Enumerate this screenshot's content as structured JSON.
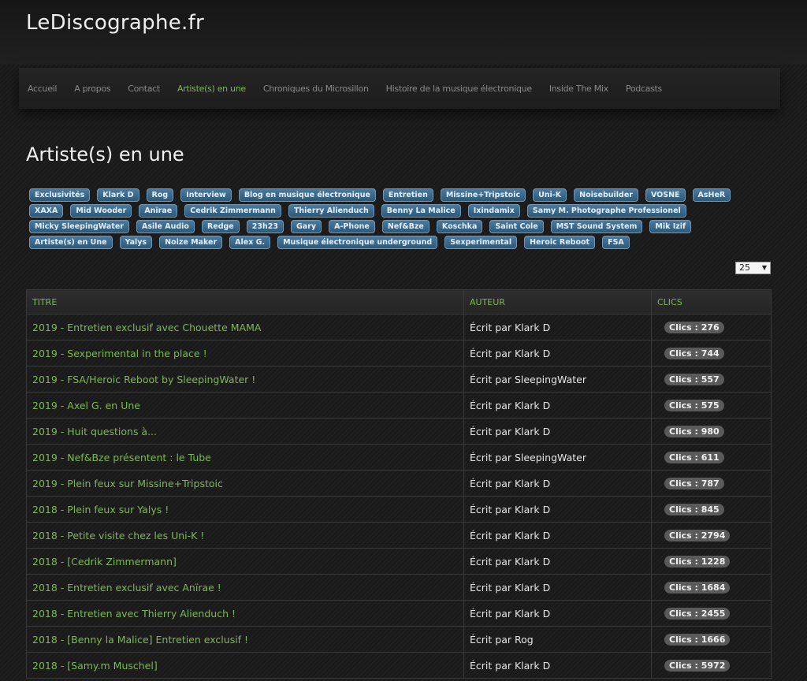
{
  "site": {
    "title": "LeDiscographe.fr"
  },
  "nav": [
    {
      "label": "Accueil",
      "active": false
    },
    {
      "label": "A propos",
      "active": false
    },
    {
      "label": "Contact",
      "active": false
    },
    {
      "label": "Artiste(s) en une",
      "active": true
    },
    {
      "label": "Chroniques du Microsillon",
      "active": false
    },
    {
      "label": "Histoire de la musique électronique",
      "active": false
    },
    {
      "label": "Inside The Mix",
      "active": false
    },
    {
      "label": "Podcasts",
      "active": false
    }
  ],
  "page": {
    "title": "Artiste(s) en une"
  },
  "tags": [
    "Exclusivités",
    "Klark D",
    "Rog",
    "Interview",
    "Blog en musique électronique",
    "Entretien",
    "Missine+Tripstoic",
    "Uni-K",
    "Noisebuilder",
    "VOSNE",
    "AsHeR",
    "XAXA",
    "Mid Wooder",
    "Anïrae",
    "Cedrik Zimmermann",
    "Thierry Alienduch",
    "Benny La Malice",
    "Ixindamix",
    "Samy M. Photographe Professionel",
    "Micky SleepingWater",
    "Asile Audio",
    "Redge",
    "23h23",
    "Gary",
    "A-Phone",
    "Nef&Bze",
    "Koschka",
    "Saint Cole",
    "MST Sound System",
    "Mik Izif",
    "Artiste(s) en Une",
    "Yalys",
    "Noize Maker",
    "Alex G.",
    "Musique électronique underground",
    "Sexperimental",
    "Heroic Reboot",
    "FSA"
  ],
  "list_limit": {
    "value": "25"
  },
  "table": {
    "headers": {
      "title": "TITRE",
      "author": "AUTEUR",
      "clicks": "CLICS"
    },
    "rows": [
      {
        "title": "2019 - Entretien exclusif avec Chouette MAMA",
        "author": "Écrit par Klark D",
        "clicks": "Clics : 276"
      },
      {
        "title": "2019 - Sexperimental in the place !",
        "author": "Écrit par Klark D",
        "clicks": "Clics : 744"
      },
      {
        "title": "2019 - FSA/Heroic Reboot by SleepingWater !",
        "author": "Écrit par SleepingWater",
        "clicks": "Clics : 557"
      },
      {
        "title": "2019 - Axel G. en Une",
        "author": "Écrit par Klark D",
        "clicks": "Clics : 575"
      },
      {
        "title": "2019 - Huit questions à...",
        "author": "Écrit par Klark D",
        "clicks": "Clics : 980"
      },
      {
        "title": "2019 - Nef&Bze présentent : le Tube",
        "author": "Écrit par SleepingWater",
        "clicks": "Clics : 611"
      },
      {
        "title": "2019 - Plein feux sur Missine+Tripstoic",
        "author": "Écrit par Klark D",
        "clicks": "Clics : 787"
      },
      {
        "title": "2018 - Plein feux sur Yalys !",
        "author": "Écrit par Klark D",
        "clicks": "Clics : 845"
      },
      {
        "title": "2018 - Petite visite chez les Uni-K !",
        "author": "Écrit par Klark D",
        "clicks": "Clics : 2794"
      },
      {
        "title": "2018 - [Cedrik Zimmermann]",
        "author": "Écrit par Klark D",
        "clicks": "Clics : 1228"
      },
      {
        "title": "2018 - Entretien exclusif avec Anïrae !",
        "author": "Écrit par Klark D",
        "clicks": "Clics : 1684"
      },
      {
        "title": "2018 - Entretien avec Thierry Alienduch !",
        "author": "Écrit par Klark D",
        "clicks": "Clics : 2455"
      },
      {
        "title": "2018 - [Benny la Malice] Entretien exclusif !",
        "author": "Écrit par Rog",
        "clicks": "Clics : 1666"
      },
      {
        "title": "2018 - [Samy.m Muschel]",
        "author": "Écrit par Klark D",
        "clicks": "Clics : 5972"
      }
    ]
  },
  "colors": {
    "accent": "#7db857",
    "tag": "#3a6688"
  }
}
